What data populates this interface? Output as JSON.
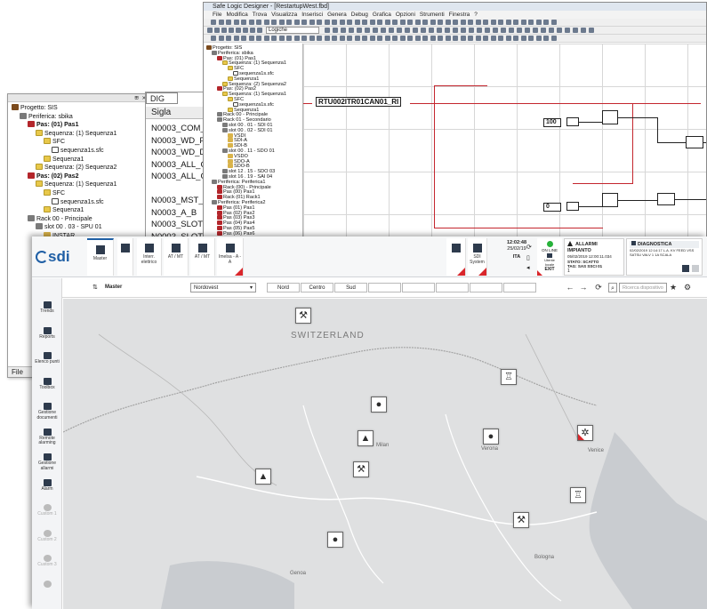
{
  "tree_window": {
    "controls": "⊞ ✕",
    "rows": [
      {
        "text": "Progetto: SIS",
        "bold": false,
        "glyph": "proj",
        "indent": 0
      },
      {
        "text": "Periferica: sbika",
        "bold": false,
        "glyph": "rack",
        "indent": 1
      },
      {
        "text": "Pas: (01) Pas1",
        "bold": true,
        "glyph": "red",
        "indent": 2
      },
      {
        "text": "Sequenza: (1) Sequenza1",
        "bold": false,
        "glyph": "folder",
        "indent": 3
      },
      {
        "text": "SFC",
        "bold": false,
        "glyph": "folder",
        "indent": 4
      },
      {
        "text": "sequenza1s.sfc",
        "bold": false,
        "glyph": "file",
        "indent": 5
      },
      {
        "text": "Sequenza1",
        "bold": false,
        "glyph": "folder",
        "indent": 4
      },
      {
        "text": "Sequenza: (2) Sequenza2",
        "bold": false,
        "glyph": "folder",
        "indent": 3
      },
      {
        "text": "Pas: (02) Pas2",
        "bold": true,
        "glyph": "red",
        "indent": 2
      },
      {
        "text": "Sequenza: (1) Sequenza1",
        "bold": false,
        "glyph": "folder",
        "indent": 3
      },
      {
        "text": "SFC",
        "bold": false,
        "glyph": "folder",
        "indent": 4
      },
      {
        "text": "sequenza1s.sfc",
        "bold": false,
        "glyph": "file",
        "indent": 5
      },
      {
        "text": "Sequenza1",
        "bold": false,
        "glyph": "folder",
        "indent": 4
      },
      {
        "text": "Rack 00 - Principale",
        "bold": false,
        "glyph": "rack",
        "indent": 2
      },
      {
        "text": "slot 00 . 03 - SPU 01",
        "bold": false,
        "glyph": "rack",
        "indent": 3
      },
      {
        "text": "INSTAR",
        "bold": false,
        "glyph": "mod",
        "indent": 4
      },
      {
        "text": "DIAG",
        "bold": false,
        "glyph": "mod",
        "indent": 4
      },
      {
        "text": "LOSAFE",
        "bold": false,
        "glyph": "mod",
        "indent": 4
      },
      {
        "text": "LOSTAR",
        "bold": false,
        "glyph": "mod",
        "indent": 4
      }
    ],
    "bottom_tab": "File"
  },
  "dig_window": {
    "tab": "DIG",
    "header": "Sigla",
    "rows": [
      "N0003_COM_SLAVE",
      "N0003_WD_PR",
      "N0003_WD_DUAL",
      "N0003_ALL_CAN_1",
      "N0003_ALL_CAN_2",
      "",
      "N0003_MST_SLV",
      "N0003_A_B",
      "N0003_SLOT004_S",
      "N0003_SLOT004_E",
      "N0003_SLOT004_A",
      "N0003_SLOT004_W",
      "N0003_SLOT005_S"
    ]
  },
  "sld_window": {
    "title": "Safe Logic Designer - [RestartupWest.fbd]",
    "menu": [
      "File",
      "Modifica",
      "Trova",
      "Visualizza",
      "Inserisci",
      "Genera",
      "Debug",
      "Grafica",
      "Opzioni",
      "Strumenti",
      "Finestra",
      "?"
    ],
    "toolbar_dropdown": "Logiche",
    "tree": [
      "Progetto: SIS",
      "Periferica: sbika",
      "Pas: (01) Pas1",
      "Sequenza: (1) Sequenza1",
      "SFC",
      "sequenza1s.sfc",
      "Sequenza1",
      "Sequenza: (2) Sequenza2",
      "Pas: (02) Pas2",
      "Sequenza: (1) Sequenza1",
      "SFC",
      "sequenza1s.sfc",
      "Sequenza1",
      "Rack 00 - Principale",
      "Rack 01 - Secondario",
      "slot 00 . 01 - SDI 01",
      "slot 00 . 02 - SDI 01",
      "VSDI",
      "SDI-A",
      "SDI-B",
      "slot 00 . 11 - SDO 01",
      "VSDO",
      "SDO-A",
      "SDO-B",
      "slot 12 . 15 - SDO 03",
      "slot 16 . 19 - SAI 04",
      "Periferica: Periferica1",
      "Rack (00) - Principale",
      "Pas (00) Pas1",
      "Rack (01) Rack1",
      "Periferica: Periferica2",
      "Pas (01) Pas1",
      "Pas (02) Pas2",
      "Pas (03) Pas3",
      "Pas (04) Pas4",
      "Pas (05) Pas5",
      "Pas (06) Pas6",
      "Pas (07) Pas7"
    ],
    "canvas": {
      "tag_label": "RTU002ITR01CAN01_RI",
      "num_a": "100",
      "num_b": "0"
    }
  },
  "scada": {
    "brand": "sdi",
    "top_buttons": [
      {
        "label": "Master",
        "selected": true,
        "flag": false
      },
      {
        "label": "",
        "selected": false,
        "flag": false
      },
      {
        "label": "Interr. elettrico",
        "selected": false,
        "flag": false
      },
      {
        "label": "AT / MT",
        "selected": false,
        "flag": false
      },
      {
        "label": "AT / MT",
        "selected": false,
        "flag": false
      },
      {
        "label": "Imelsa - A - A",
        "selected": false,
        "flag": true
      }
    ],
    "system_buttons": [
      {
        "label": "",
        "flag": true
      },
      {
        "label": "SDI System",
        "flag": true
      }
    ],
    "status": {
      "time": "12:02:48",
      "date": "25/02/19",
      "lang": "ITA",
      "online_label": "ON LINE",
      "user_label": "Utente locale",
      "exit_label": "EXIT"
    },
    "alarm_panel": {
      "title": "ALLARMI IMPIANTO",
      "line1": "05/02/2019 12:00:11.034",
      "stato": "STATO: SCATTO",
      "tag": "TAG: SAS SSCI 01",
      "count": "1"
    },
    "diag_panel": {
      "title": "DIAGNOSTICA",
      "line1": "02/02/2019 12:14:17 L.A. KV FEED VSS",
      "line2": "SATSU VALV 1 1A SCALA"
    },
    "master_label": "Master",
    "region_dropdown": "Nordovest",
    "region_tabs": [
      "Nord",
      "Centro",
      "Sud",
      "",
      "",
      "",
      "",
      ""
    ],
    "search_placeholder": "Ricerca dispositivo",
    "sidebar": [
      {
        "label": "Trends",
        "dim": false
      },
      {
        "label": "Reports",
        "dim": false
      },
      {
        "label": "Elenco punti",
        "dim": false
      },
      {
        "label": "Toolbox",
        "dim": false
      },
      {
        "label": "Gestione documenti",
        "dim": false
      },
      {
        "label": "Remote alarming",
        "dim": false
      },
      {
        "label": "Gestione allarmi",
        "dim": false
      },
      {
        "label": "Alarm",
        "dim": false
      },
      {
        "label": "Custom 1",
        "dim": true
      },
      {
        "label": "Custom 2",
        "dim": true
      },
      {
        "label": "Custom 3",
        "dim": true
      },
      {
        "label": "",
        "dim": true
      }
    ],
    "map_labels": {
      "country": "SWITZERLAND",
      "city1": "Milan",
      "city2": "Verona",
      "city3": "Bologna",
      "city4": "Venice",
      "city5": "Genoa"
    },
    "map_pins": [
      {
        "icon": "valve-icon",
        "glyph": "⚒",
        "alarm": false
      },
      {
        "icon": "tower-icon",
        "glyph": "♖",
        "alarm": false
      },
      {
        "icon": "drop-icon",
        "glyph": "●",
        "alarm": false
      },
      {
        "icon": "drop-icon",
        "glyph": "●",
        "alarm": false
      },
      {
        "icon": "fire-icon",
        "glyph": "▲",
        "alarm": false
      },
      {
        "icon": "gears-icon",
        "glyph": "✲",
        "alarm": true
      },
      {
        "icon": "valve-icon",
        "glyph": "⚒",
        "alarm": false
      },
      {
        "icon": "fire-icon",
        "glyph": "▲",
        "alarm": false
      },
      {
        "icon": "tower-icon",
        "glyph": "♖",
        "alarm": false
      },
      {
        "icon": "valve-icon",
        "glyph": "⚒",
        "alarm": false
      },
      {
        "icon": "drop-icon",
        "glyph": "●",
        "alarm": false
      }
    ],
    "colors": {
      "brand": "#1f5fa5",
      "alarm": "#d9262b",
      "map": "#dfe0e1"
    }
  }
}
